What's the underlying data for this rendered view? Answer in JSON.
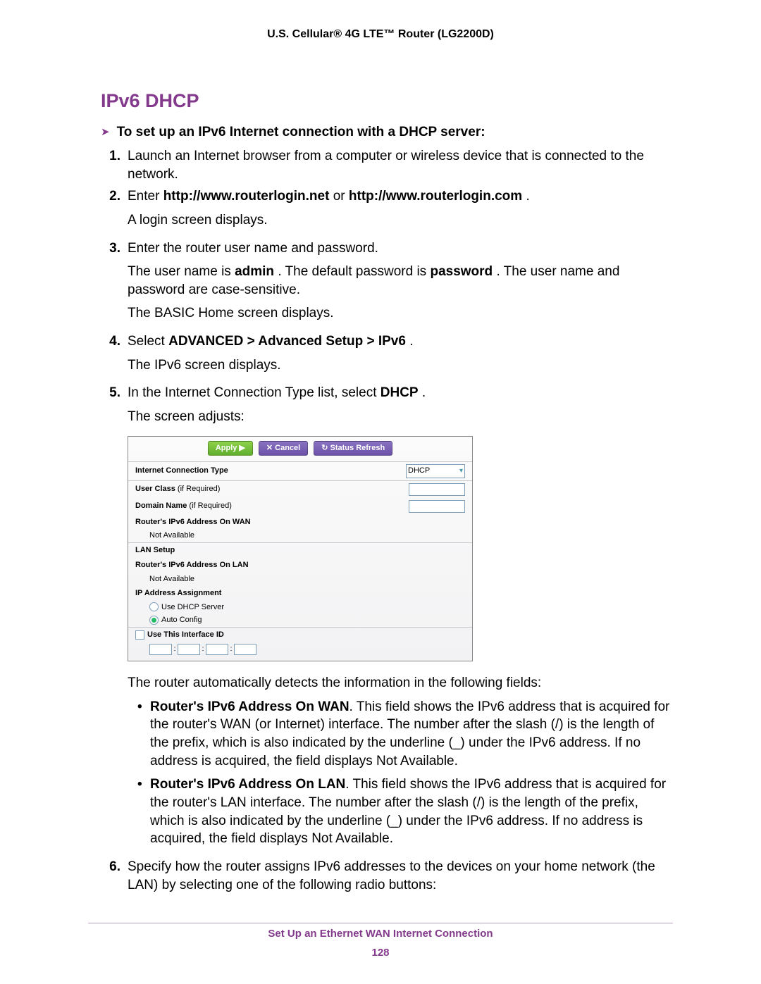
{
  "header": {
    "title": "U.S. Cellular® 4G LTE™ Router (LG2200D)"
  },
  "section": {
    "title": "IPv6 DHCP"
  },
  "proc": {
    "head": "To set up an IPv6 Internet connection with a DHCP server:"
  },
  "steps": {
    "s1": {
      "num": "1.",
      "text": "Launch an Internet browser from a computer or wireless device that is connected to the network."
    },
    "s2": {
      "num": "2.",
      "prefix": "Enter ",
      "url1": "http://www.routerlogin.net",
      "or": " or ",
      "url2": "http://www.routerlogin.com",
      "suffix": ".",
      "p1": "A login screen displays."
    },
    "s3": {
      "num": "3.",
      "text": "Enter the router user name and password.",
      "p1a": "The user name is ",
      "p1b": "admin",
      "p1c": ". The default password is ",
      "p1d": "password",
      "p1e": ". The user name and password are case-sensitive.",
      "p2": "The BASIC Home screen displays."
    },
    "s4": {
      "num": "4.",
      "prefix": "Select ",
      "path": "ADVANCED > Advanced Setup > IPv6",
      "suffix": ".",
      "p1": "The IPv6 screen displays."
    },
    "s5": {
      "num": "5.",
      "prefix": "In the Internet Connection Type list, select ",
      "sel": "DHCP",
      "suffix": ".",
      "p1": "The screen adjusts:",
      "after": "The router automatically detects the information in the following fields:",
      "b1_label": "Router's IPv6 Address On WAN",
      "b1_text": ". This field shows the IPv6 address that is acquired for the router's WAN (or Internet) interface. The number after the slash (/) is the length of the prefix, which is also indicated by the underline (_) under the IPv6 address. If no address is acquired, the field displays Not Available.",
      "b2_label": "Router's IPv6 Address On LAN",
      "b2_text": ". This field shows the IPv6 address that is acquired for the router's LAN interface. The number after the slash (/) is the length of the prefix, which is also indicated by the underline (_) under the IPv6 address. If no address is acquired, the field displays Not Available."
    },
    "s6": {
      "num": "6.",
      "text": "Specify how the router assigns IPv6 addresses to the devices on your home network (the LAN) by selecting one of the following radio buttons:"
    }
  },
  "panel": {
    "btn_apply": "Apply ▶",
    "btn_cancel": "✕ Cancel",
    "btn_refresh": "↻ Status Refresh",
    "ict_label": "Internet Connection Type",
    "ict_value": "DHCP",
    "user_class": "User Class",
    "if_req": "  (if Required)",
    "domain_name": "Domain Name",
    "wan_label": "Router's IPv6 Address On WAN",
    "not_avail": "Not Available",
    "lan_setup": "LAN Setup",
    "lan_label": "Router's IPv6 Address On LAN",
    "ip_assign": "IP Address Assignment",
    "use_dhcp": "Use DHCP Server",
    "auto_cfg": "Auto Config",
    "use_ifid": "Use This Interface ID"
  },
  "footer": {
    "chapter": "Set Up an Ethernet WAN Internet Connection",
    "page": "128"
  }
}
